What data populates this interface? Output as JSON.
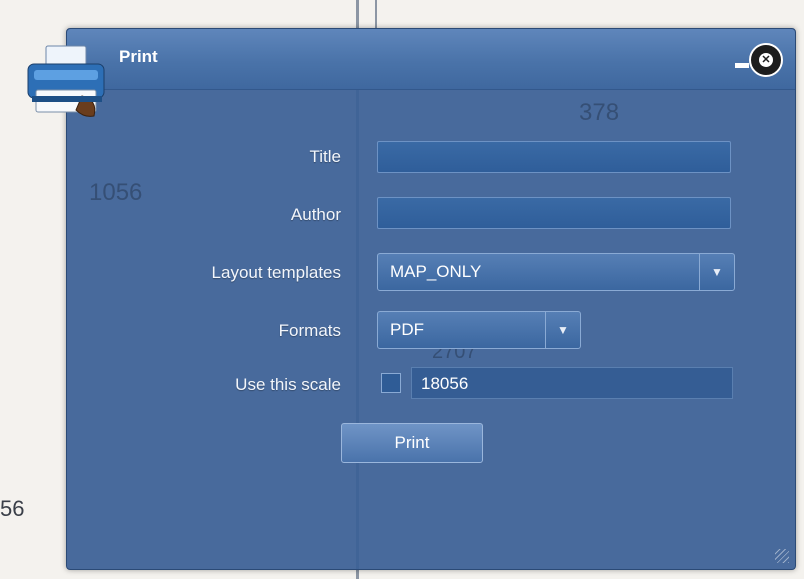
{
  "map": {
    "labels": [
      "1056",
      "378",
      "2707",
      "56"
    ]
  },
  "dialog": {
    "title": "Print",
    "icons": {
      "app": "printer-icon",
      "minimize": "minimize-icon",
      "close": "close-icon",
      "resize": "resize-grip-icon"
    },
    "fields": {
      "title_label": "Title",
      "title_value": "",
      "author_label": "Author",
      "author_value": "",
      "layout_label": "Layout templates",
      "layout_value": "MAP_ONLY",
      "formats_label": "Formats",
      "formats_value": "PDF",
      "scale_label": "Use this scale",
      "scale_checked": false,
      "scale_value": "18056"
    },
    "print_button": "Print"
  }
}
